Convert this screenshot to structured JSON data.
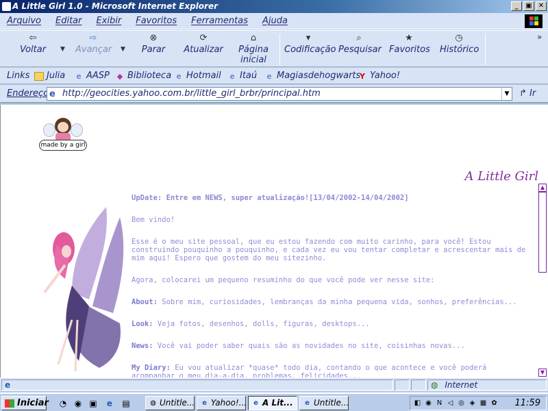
{
  "window": {
    "title": "A Little Girl 1.0 - Microsoft Internet Explorer",
    "controls": [
      "_",
      "▣",
      "✕"
    ]
  },
  "menu": [
    "Arquivo",
    "Editar",
    "Exibir",
    "Favoritos",
    "Ferramentas",
    "Ajuda"
  ],
  "toolbar": {
    "back": "Voltar",
    "forward": "Avançar",
    "stop": "Parar",
    "refresh": "Atualizar",
    "home_line1": "Página",
    "home_line2": "inicial",
    "encoding": "Codificação",
    "search": "Pesquisar",
    "favorites": "Favoritos",
    "history": "Histórico",
    "more": "»"
  },
  "links": {
    "label": "Links",
    "items": [
      "Julia",
      "AASP",
      "Biblioteca",
      "Hotmail",
      "Itaú",
      "Magiasdehogwarts",
      "Yahoo!"
    ]
  },
  "address": {
    "label": "Endereço",
    "url": "http://geocities.yahoo.com.br/little_girl_brbr/principal.htm",
    "go": "Ir"
  },
  "page": {
    "badge": "made by a girl",
    "site_title": "A Little Girl",
    "update": "UpDate: Entre em NEWS, super atualização![13/04/2002-14/04/2002]",
    "welcome": "Bem vindo!",
    "intro": "Esse é o meu site pessoal, que eu estou fazendo com muito carinho, para você! Estou construindo pouquinho a pouquinho, e cada vez eu vou tentar completar e acrescentar mais de mim aqui! Espero que gostem do meu sitezinho.",
    "summary": "Agora, colocarei um pequeno resuminho do que você pode ver nesse site:",
    "about_label": "About:",
    "about_text": " Sobre mim, curiosidades, lembranças da minha pequena vida, sonhos, preferências...",
    "look_label": "Look:",
    "look_text": " Veja fotos, desenhos, dolls, figuras, desktops...",
    "news_label": "News:",
    "news_text": " Você vai poder saber quais são as novidades no site, coisinhas novas...",
    "diary_label": "My Diary:",
    "diary_text": " Eu vou atualizar *quase* todo dia, contando o que acontece e você poderá acompanhar o meu dia-a-dia, problemas, felicidades..."
  },
  "status": {
    "zone": "Internet"
  },
  "taskbar": {
    "start": "Iniciar",
    "tasks": [
      "Untitle...",
      "Yahoo!...",
      "A Lit...",
      "Untitle..."
    ],
    "clock": "11:59"
  }
}
